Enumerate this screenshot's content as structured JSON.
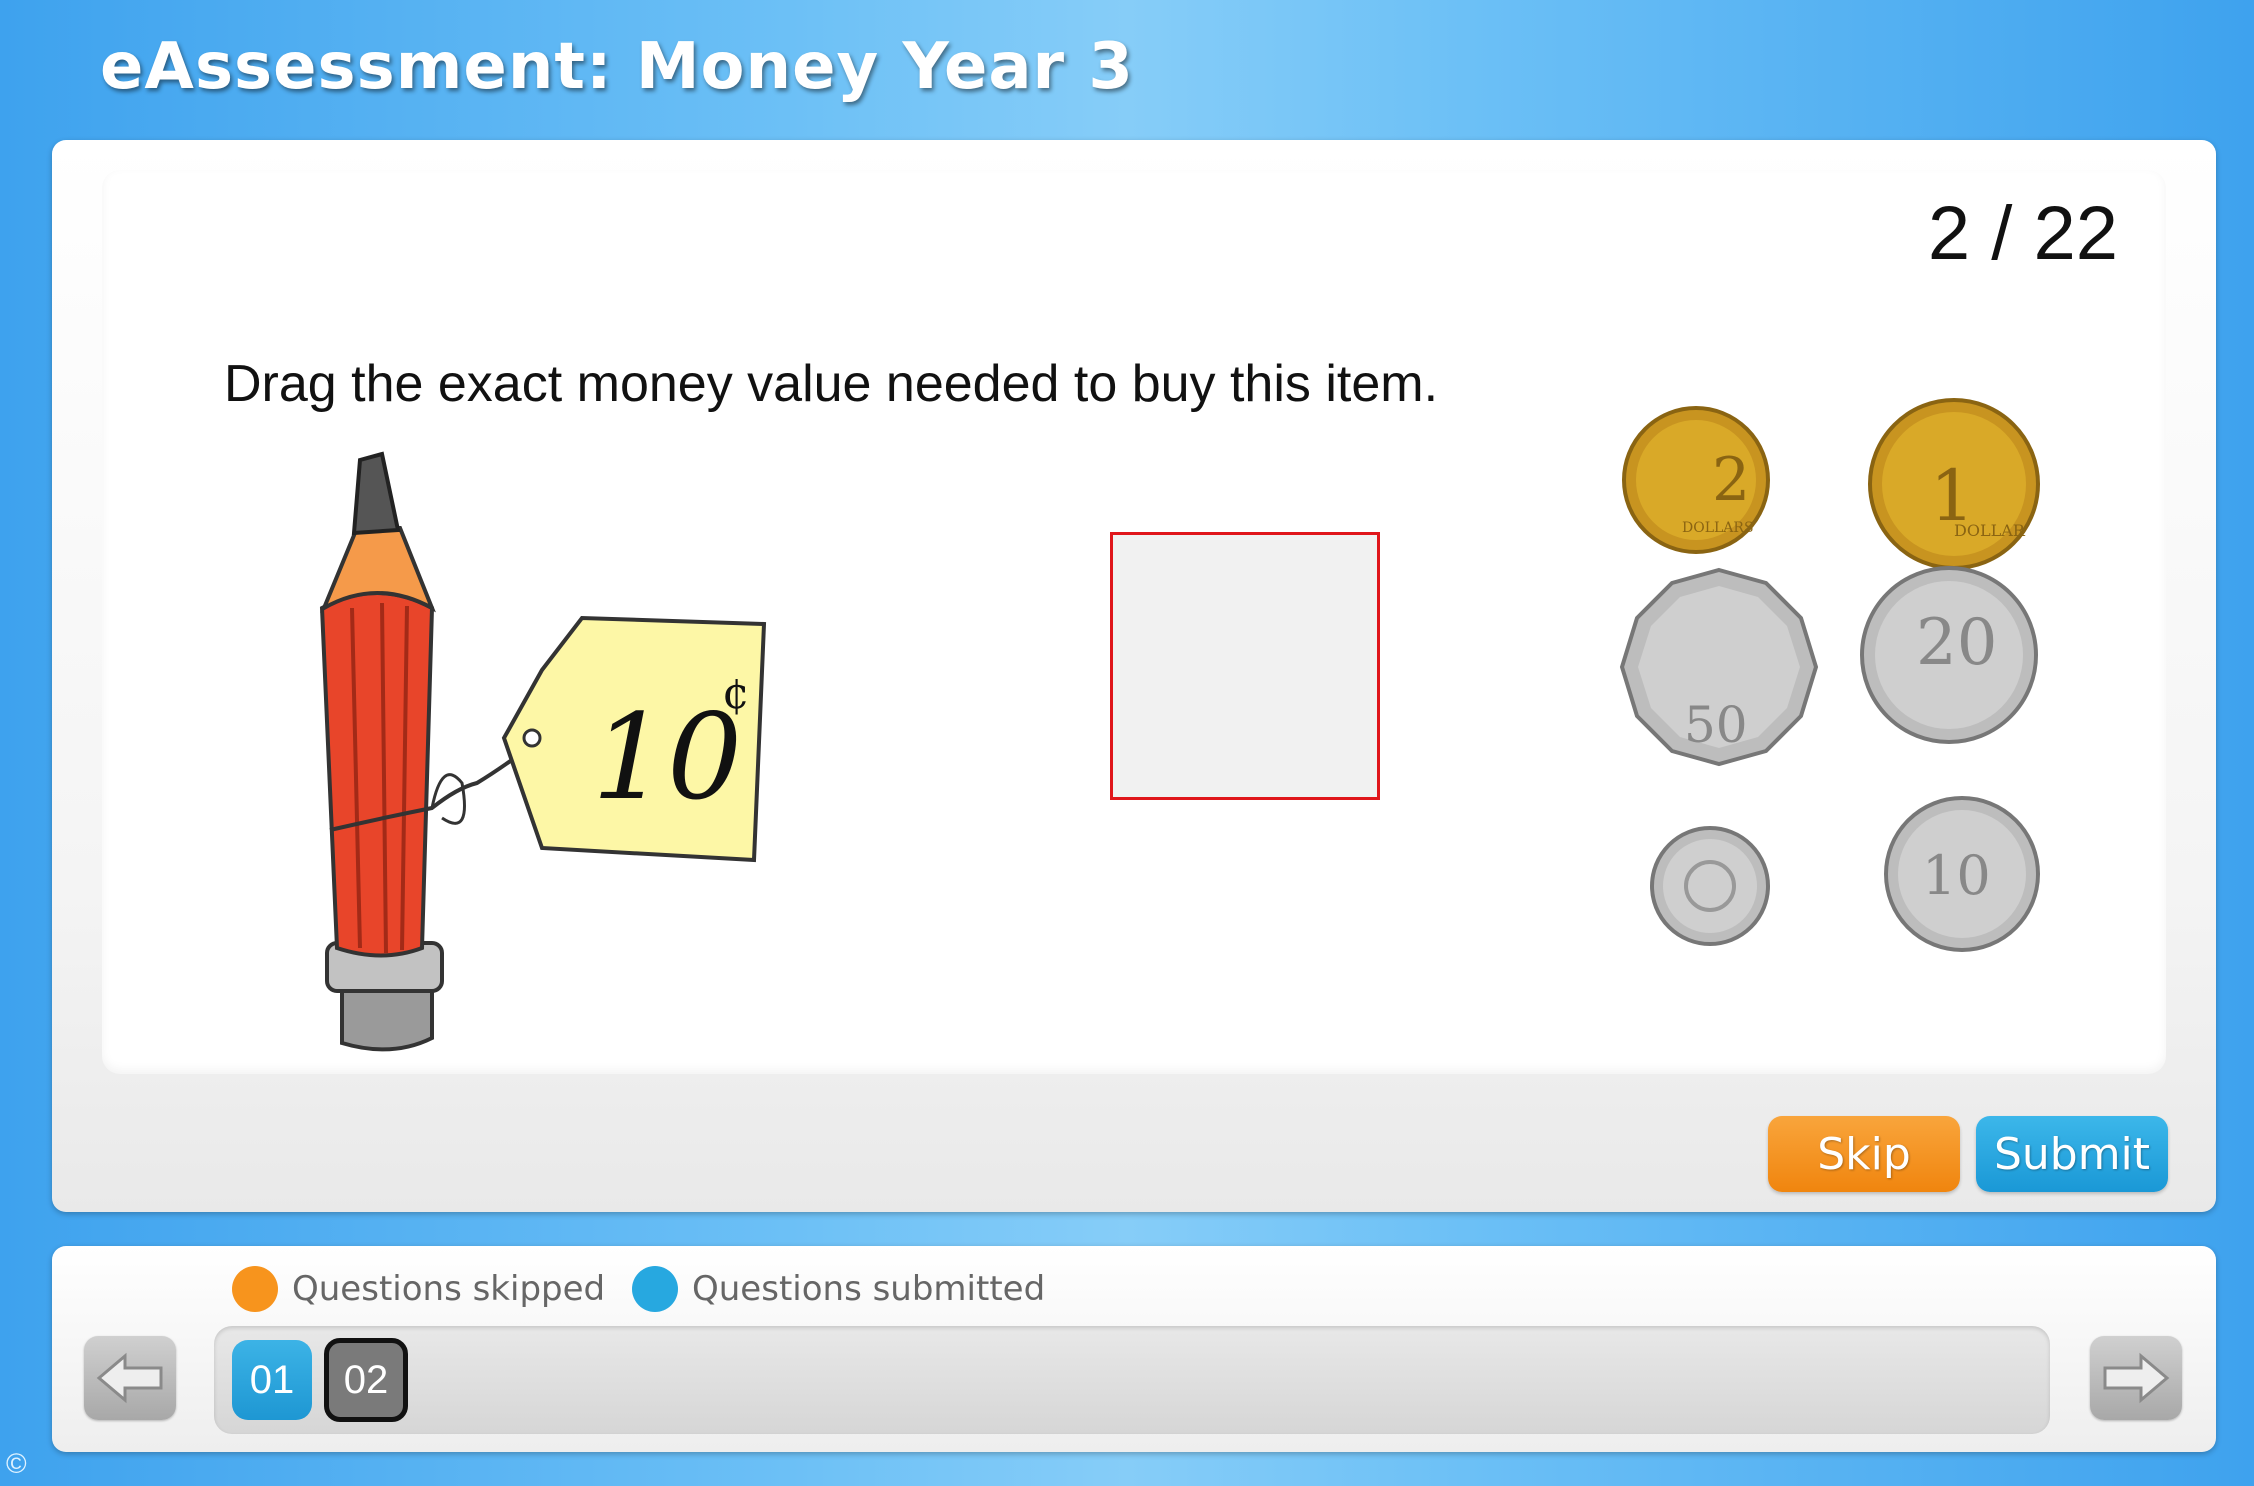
{
  "header": {
    "title": "eAssessment: Money Year 3"
  },
  "question": {
    "counter": "2 / 22",
    "prompt": "Drag the exact money value needed to buy this item.",
    "price_tag": "10",
    "price_symbol": "¢"
  },
  "coins": [
    {
      "name": "two-dollar",
      "label": "2",
      "sub": "DOLLARS",
      "color": "#d9a928"
    },
    {
      "name": "one-dollar",
      "label": "1",
      "sub": "DOLLAR",
      "color": "#d9a928"
    },
    {
      "name": "fifty-cent",
      "label": "50",
      "color": "#c9c9c9"
    },
    {
      "name": "twenty-cent",
      "label": "20",
      "color": "#c9c9c9"
    },
    {
      "name": "five-cent",
      "label": "",
      "color": "#c9c9c9"
    },
    {
      "name": "ten-cent",
      "label": "10",
      "color": "#c9c9c9"
    }
  ],
  "actions": {
    "skip_label": "Skip",
    "submit_label": "Submit"
  },
  "legend": {
    "skipped_label": "Questions skipped",
    "submitted_label": "Questions submitted",
    "skipped_color": "#f7941d",
    "submitted_color": "#27a8e0"
  },
  "navigation": {
    "questions": [
      {
        "label": "01",
        "status": "submitted"
      },
      {
        "label": "02",
        "status": "current"
      }
    ],
    "prev_icon": "left-arrow-icon",
    "next_icon": "right-arrow-icon"
  },
  "footer": {
    "copyright_symbol": "©"
  }
}
